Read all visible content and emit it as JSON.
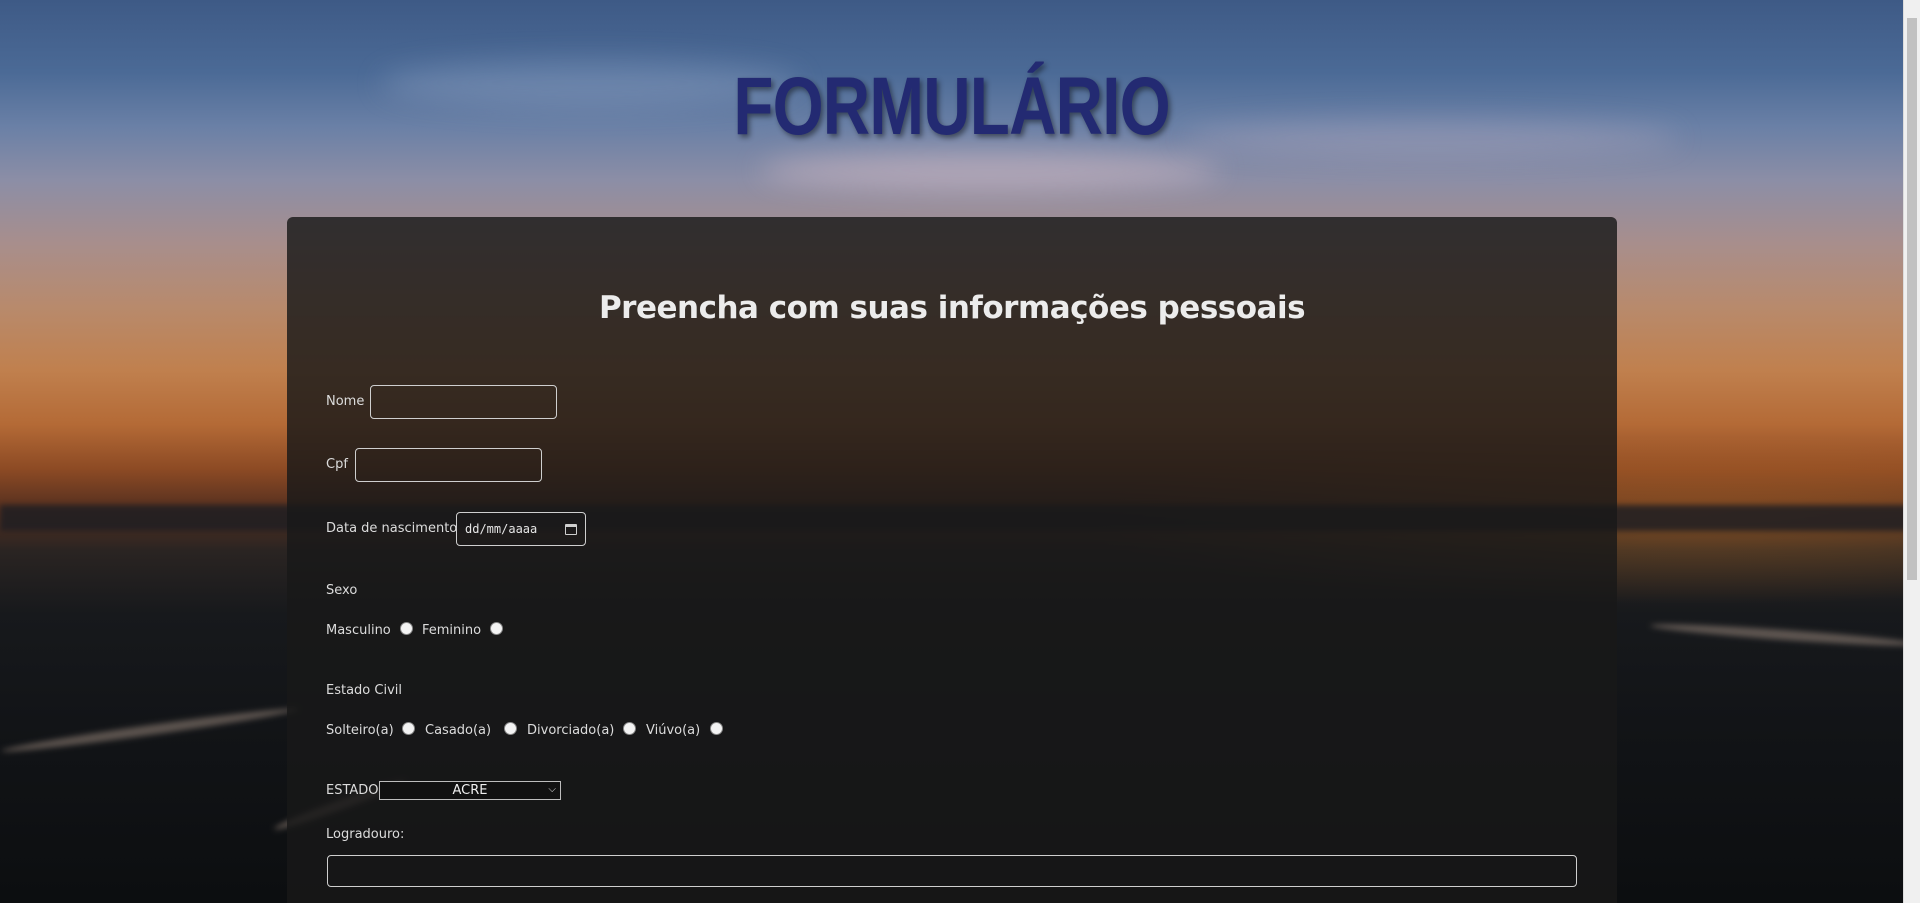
{
  "page": {
    "title": "FORMULÁRIO",
    "title_color": "#232a72"
  },
  "form": {
    "heading": "Preencha com suas informações pessoais",
    "fields": {
      "nome_label": "Nome",
      "nome_value": "",
      "cpf_label": "Cpf",
      "cpf_value": "",
      "nascimento_label": "Data de nascimento",
      "nascimento_placeholder": "dd/mm/aaaa"
    },
    "sexo": {
      "label": "Sexo",
      "options": [
        "Masculino",
        "Feminino"
      ]
    },
    "estado_civil": {
      "label": "Estado Civil",
      "options": [
        "Solteiro(a)",
        "Casado(a)",
        "Divorciado(a)",
        "Viúvo(a)"
      ]
    },
    "estado": {
      "label": "ESTADO",
      "selected": "ACRE"
    },
    "logradouro": {
      "label": "Logradouro:",
      "value": ""
    }
  },
  "icons": {
    "calendar": "calendar-icon",
    "dropdown": "chevron-down-icon"
  }
}
